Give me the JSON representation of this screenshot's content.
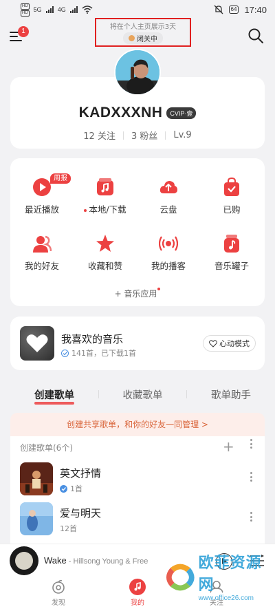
{
  "status_bar": {
    "hd_labels": [
      "HD",
      "HD"
    ],
    "network": [
      "5G",
      "4G"
    ],
    "battery": "64",
    "time": "17:40"
  },
  "topbar": {
    "menu_badge": "1",
    "notice_text": "将在个人主页展示3天",
    "status_pill": "闭关中"
  },
  "profile": {
    "username": "KADXXXNH",
    "vip_badge": "CVIP·壹",
    "following": "12 关注",
    "fans": "3 粉丝",
    "level": "Lv.9"
  },
  "functions": {
    "weekly_tag": "周报",
    "items": [
      {
        "label": "最近播放",
        "icon": "play-icon",
        "dot": false
      },
      {
        "label": "本地/下载",
        "icon": "music-folder-icon",
        "dot": true
      },
      {
        "label": "云盘",
        "icon": "cloud-upload-icon",
        "dot": false
      },
      {
        "label": "已购",
        "icon": "shopping-bag-icon",
        "dot": false
      },
      {
        "label": "我的好友",
        "icon": "friends-icon",
        "dot": false
      },
      {
        "label": "收藏和赞",
        "icon": "star-icon",
        "dot": false
      },
      {
        "label": "我的播客",
        "icon": "podcast-icon",
        "dot": false
      },
      {
        "label": "音乐罐子",
        "icon": "music-jar-icon",
        "dot": false
      }
    ],
    "more_apps": "+ 音乐应用"
  },
  "liked": {
    "title": "我喜欢的音乐",
    "subtitle": "141首，已下载1首",
    "heartbeat_mode": "心动模式"
  },
  "tabs": [
    {
      "label": "创建歌单",
      "active": true
    },
    {
      "label": "收藏歌单",
      "active": false
    },
    {
      "label": "歌单助手",
      "active": false
    }
  ],
  "share_banner": "创建共享歌单，和你的好友一同管理 >",
  "playlists": {
    "header": "创建歌单(6个)",
    "add_symbol": "+",
    "items": [
      {
        "name": "英文抒情",
        "count": "1首",
        "downloaded": true
      },
      {
        "name": "爱与明天",
        "count": "12首",
        "downloaded": false
      }
    ]
  },
  "mini_player": {
    "title": "Wake",
    "artist": " - Hillsong Young & Free"
  },
  "bottom_nav": [
    {
      "label": "发现",
      "active": false
    },
    {
      "label": "我的",
      "active": true
    },
    {
      "label": "关注",
      "active": false
    }
  ],
  "watermark": {
    "main": "欧菲资源网",
    "sub": "www.office26.com"
  },
  "colors": {
    "accent": "#ec4141",
    "background": "#f2f2f4",
    "banner_text": "#d9653b",
    "watermark": "#2fa1d8"
  }
}
